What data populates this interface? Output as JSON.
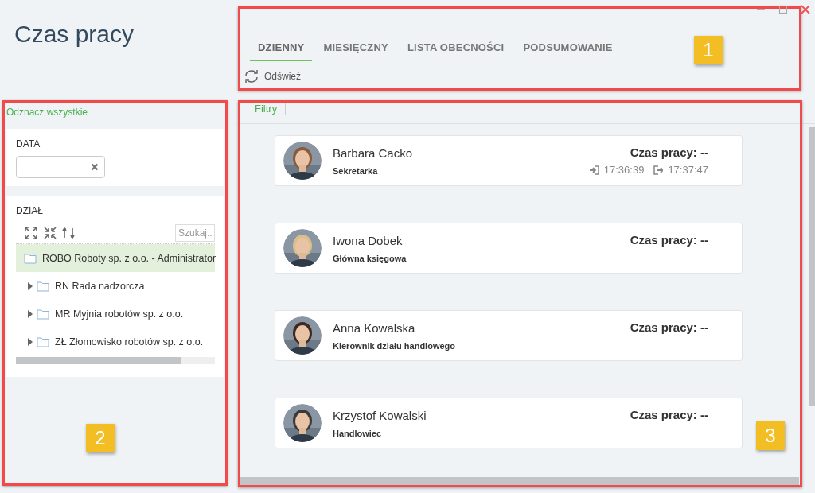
{
  "title": "Czas pracy",
  "window_controls": [
    {
      "kind": "minimize"
    },
    {
      "kind": "maximize"
    },
    {
      "kind": "close"
    }
  ],
  "tabs": [
    {
      "label": "DZIENNY",
      "selected": true
    },
    {
      "label": "MIESIĘCZNY",
      "selected": false
    },
    {
      "label": "LISTA OBECNOŚCI",
      "selected": false
    },
    {
      "label": "PODSUMOWANIE",
      "selected": false
    }
  ],
  "refresh_button": "Odśwież",
  "sidebar": {
    "deselect_all": "Odznacz wszystkie",
    "date_filter": {
      "label": "DATA"
    },
    "department_filter": {
      "label": "DZIAŁ",
      "search": {
        "placeholder": "Szukaj.."
      },
      "tree": [
        {
          "label": "ROBO Roboty sp. z o.o. - Administrator",
          "selected": true,
          "children": [
            {
              "label": "RN Rada nadzorcza",
              "selected": false,
              "expanded": false
            },
            {
              "label": "MR Myjnia robotów sp. z o.o.",
              "selected": false,
              "expanded": false
            },
            {
              "label": "ZŁ Złomowisko robotów sp. z o.o.",
              "selected": false,
              "expanded": false
            }
          ]
        }
      ]
    }
  },
  "filters_button": "Filtry",
  "employees": [
    {
      "name": "Barbara Cacko",
      "role": "Sekretarka",
      "work_time": "Czas pracy: --",
      "clock_in": "17:36:39",
      "clock_out": "17:37:47"
    },
    {
      "name": "Iwona Dobek",
      "role": "Główna księgowa",
      "work_time": "Czas pracy: --"
    },
    {
      "name": "Anna Kowalska",
      "role": "Kierownik działu handlowego",
      "work_time": "Czas pracy: --"
    },
    {
      "name": "Krzystof Kowalski",
      "role": "Handlowiec",
      "work_time": "Czas pracy: --"
    }
  ],
  "annotations": [
    {
      "number": "1"
    },
    {
      "number": "2"
    },
    {
      "number": "3"
    }
  ]
}
